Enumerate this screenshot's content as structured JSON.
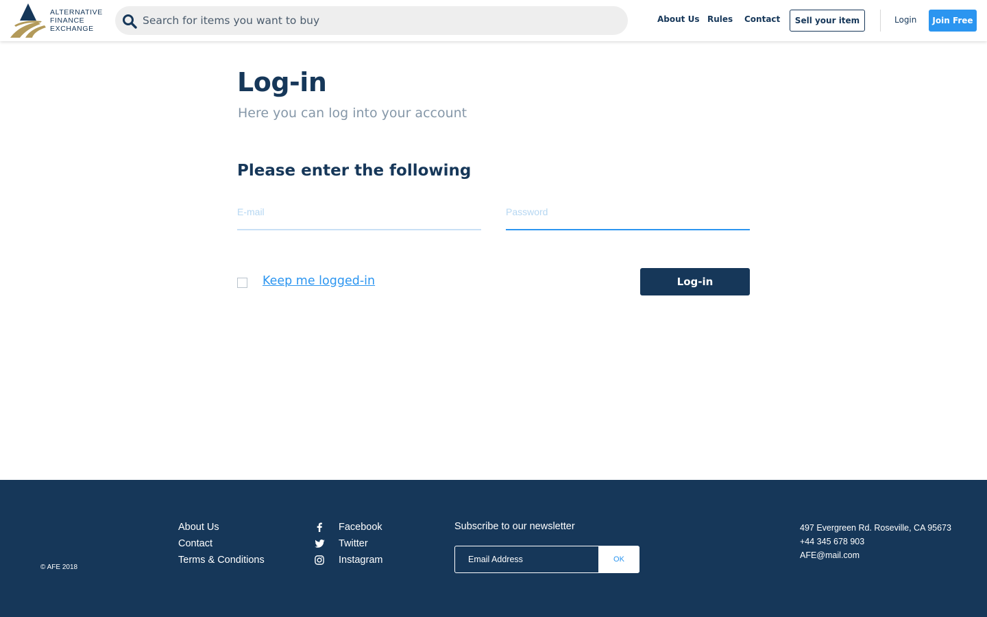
{
  "header": {
    "logo": {
      "line1": "ALTERNATIVE",
      "line2": "FINANCE",
      "line3": "EXCHANGE"
    },
    "search": {
      "placeholder": "Search for items you want to buy",
      "icon": "search-icon"
    },
    "nav": [
      {
        "label": "About Us"
      },
      {
        "label": "Rules"
      },
      {
        "label": "Contact"
      }
    ],
    "sell_label": "Sell your item",
    "login_label": "Login",
    "join_label": "Join Free"
  },
  "main": {
    "title": "Log-in",
    "subtitle": "Here you can log into your account",
    "section_heading": "Please enter the following",
    "email_placeholder": "E-mail",
    "password_placeholder": "Password",
    "keep_logged_in": "Keep me logged-in",
    "login_button": "Log-in"
  },
  "footer": {
    "copyright": "© AFE 2018",
    "links": [
      {
        "label": "About Us"
      },
      {
        "label": "Contact"
      },
      {
        "label": "Terms & Conditions"
      }
    ],
    "social": [
      {
        "label": "Facebook",
        "icon": "facebook-icon"
      },
      {
        "label": "Twitter",
        "icon": "twitter-icon"
      },
      {
        "label": "Instagram",
        "icon": "instagram-icon"
      }
    ],
    "newsletter": {
      "title": "Subscribe to our newsletter",
      "placeholder": "Email Address",
      "button": "OK"
    },
    "contact": {
      "address": "497 Evergreen Rd. Roseville, CA 95673",
      "phone": "+44 345 678 903",
      "email": "AFE@mail.com"
    }
  },
  "colors": {
    "navy": "#163759",
    "accent_blue": "#2b95f0",
    "gold": "#b39a5a",
    "muted_text": "#8597a8"
  }
}
